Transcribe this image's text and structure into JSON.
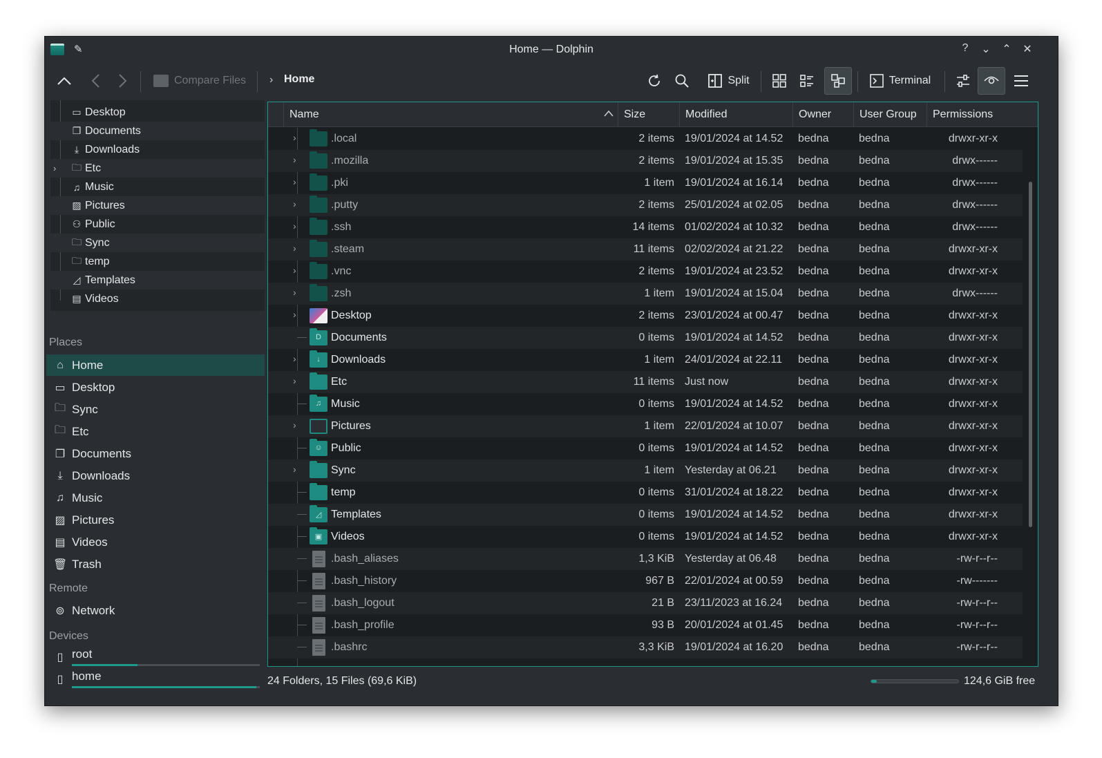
{
  "window": {
    "title": "Home — Dolphin",
    "controls": [
      "?",
      "⌄",
      "⌃",
      "✕"
    ]
  },
  "toolbar": {
    "compare_label": "Compare Files",
    "breadcrumb": "Home",
    "split_label": "Split",
    "terminal_label": "Terminal"
  },
  "folders_panel": [
    {
      "label": "Desktop",
      "icon": "desktop-icon",
      "expandable": false
    },
    {
      "label": "Documents",
      "icon": "documents-icon",
      "expandable": false
    },
    {
      "label": "Downloads",
      "icon": "downloads-icon",
      "expandable": false
    },
    {
      "label": "Etc",
      "icon": "folder-icon",
      "expandable": true
    },
    {
      "label": "Music",
      "icon": "music-icon",
      "expandable": false
    },
    {
      "label": "Pictures",
      "icon": "pictures-icon",
      "expandable": false
    },
    {
      "label": "Public",
      "icon": "public-icon",
      "expandable": false
    },
    {
      "label": "Sync",
      "icon": "folder-icon",
      "expandable": false
    },
    {
      "label": "temp",
      "icon": "folder-icon",
      "expandable": false
    },
    {
      "label": "Templates",
      "icon": "templates-icon",
      "expandable": false
    },
    {
      "label": "Videos",
      "icon": "videos-icon",
      "expandable": false
    }
  ],
  "places": {
    "heading": "Places",
    "items": [
      {
        "label": "Home",
        "icon": "home-icon",
        "selected": true
      },
      {
        "label": "Desktop",
        "icon": "desktop-icon"
      },
      {
        "label": "Sync",
        "icon": "folder-icon"
      },
      {
        "label": "Etc",
        "icon": "folder-icon"
      },
      {
        "label": "Documents",
        "icon": "documents-icon"
      },
      {
        "label": "Downloads",
        "icon": "downloads-icon"
      },
      {
        "label": "Music",
        "icon": "music-icon"
      },
      {
        "label": "Pictures",
        "icon": "pictures-icon"
      },
      {
        "label": "Videos",
        "icon": "videos-icon"
      },
      {
        "label": "Trash",
        "icon": "trash-icon"
      }
    ]
  },
  "remote": {
    "heading": "Remote",
    "items": [
      {
        "label": "Network",
        "icon": "network-icon"
      }
    ]
  },
  "devices": {
    "heading": "Devices",
    "items": [
      {
        "label": "root",
        "icon": "drive-icon",
        "usage": 0.35
      },
      {
        "label": "home",
        "icon": "drive-icon",
        "usage": 0.98
      }
    ]
  },
  "columns": {
    "name": "Name",
    "size": "Size",
    "modified": "Modified",
    "owner": "Owner",
    "group": "User Group",
    "permissions": "Permissions"
  },
  "files": [
    {
      "name": ".local",
      "kind": "folder",
      "hidden": true,
      "expandable": true,
      "size": "2 items",
      "modified": "19/01/2024 at 14.52",
      "owner": "bedna",
      "group": "bedna",
      "perm": "drwxr-xr-x"
    },
    {
      "name": ".mozilla",
      "kind": "folder",
      "hidden": true,
      "expandable": true,
      "size": "2 items",
      "modified": "19/01/2024 at 15.35",
      "owner": "bedna",
      "group": "bedna",
      "perm": "drwx------"
    },
    {
      "name": ".pki",
      "kind": "folder",
      "hidden": true,
      "expandable": true,
      "size": "1 item",
      "modified": "19/01/2024 at 16.14",
      "owner": "bedna",
      "group": "bedna",
      "perm": "drwx------"
    },
    {
      "name": ".putty",
      "kind": "folder",
      "hidden": true,
      "expandable": true,
      "size": "2 items",
      "modified": "25/01/2024 at 02.05",
      "owner": "bedna",
      "group": "bedna",
      "perm": "drwx------"
    },
    {
      "name": ".ssh",
      "kind": "folder",
      "hidden": true,
      "expandable": true,
      "size": "14 items",
      "modified": "01/02/2024 at 10.32",
      "owner": "bedna",
      "group": "bedna",
      "perm": "drwx------"
    },
    {
      "name": ".steam",
      "kind": "folder",
      "hidden": true,
      "expandable": true,
      "size": "11 items",
      "modified": "02/02/2024 at 21.22",
      "owner": "bedna",
      "group": "bedna",
      "perm": "drwxr-xr-x"
    },
    {
      "name": ".vnc",
      "kind": "folder",
      "hidden": true,
      "expandable": true,
      "size": "2 items",
      "modified": "19/01/2024 at 23.52",
      "owner": "bedna",
      "group": "bedna",
      "perm": "drwxr-xr-x"
    },
    {
      "name": ".zsh",
      "kind": "folder",
      "hidden": true,
      "expandable": true,
      "size": "1 item",
      "modified": "19/01/2024 at 15.04",
      "owner": "bedna",
      "group": "bedna",
      "perm": "drwx------"
    },
    {
      "name": "Desktop",
      "kind": "desktop",
      "hidden": false,
      "expandable": true,
      "size": "2 items",
      "modified": "23/01/2024 at 00.47",
      "owner": "bedna",
      "group": "bedna",
      "perm": "drwxr-xr-x"
    },
    {
      "name": "Documents",
      "kind": "folder",
      "glyph": "D",
      "hidden": false,
      "expandable": false,
      "size": "0 items",
      "modified": "19/01/2024 at 14.52",
      "owner": "bedna",
      "group": "bedna",
      "perm": "drwxr-xr-x"
    },
    {
      "name": "Downloads",
      "kind": "folder",
      "glyph": "↓",
      "hidden": false,
      "expandable": true,
      "size": "1 item",
      "modified": "24/01/2024 at 22.11",
      "owner": "bedna",
      "group": "bedna",
      "perm": "drwxr-xr-x"
    },
    {
      "name": "Etc",
      "kind": "folder",
      "hidden": false,
      "expandable": true,
      "size": "11 items",
      "modified": "Just now",
      "owner": "bedna",
      "group": "bedna",
      "perm": "drwxr-xr-x"
    },
    {
      "name": "Music",
      "kind": "folder",
      "glyph": "♫",
      "hidden": false,
      "expandable": false,
      "size": "0 items",
      "modified": "19/01/2024 at 14.52",
      "owner": "bedna",
      "group": "bedna",
      "perm": "drwxr-xr-x"
    },
    {
      "name": "Pictures",
      "kind": "pictures",
      "hidden": false,
      "expandable": true,
      "size": "1 item",
      "modified": "22/01/2024 at 10.07",
      "owner": "bedna",
      "group": "bedna",
      "perm": "drwxr-xr-x"
    },
    {
      "name": "Public",
      "kind": "folder",
      "glyph": "☺",
      "hidden": false,
      "expandable": false,
      "size": "0 items",
      "modified": "19/01/2024 at 14.52",
      "owner": "bedna",
      "group": "bedna",
      "perm": "drwxr-xr-x"
    },
    {
      "name": "Sync",
      "kind": "folder",
      "hidden": false,
      "expandable": true,
      "size": "1 item",
      "modified": "Yesterday at 06.21",
      "owner": "bedna",
      "group": "bedna",
      "perm": "drwxr-xr-x"
    },
    {
      "name": "temp",
      "kind": "folder",
      "hidden": false,
      "expandable": false,
      "size": "0 items",
      "modified": "31/01/2024 at 18.22",
      "owner": "bedna",
      "group": "bedna",
      "perm": "drwxr-xr-x"
    },
    {
      "name": "Templates",
      "kind": "folder",
      "glyph": "◿",
      "hidden": false,
      "expandable": false,
      "size": "0 items",
      "modified": "19/01/2024 at 14.52",
      "owner": "bedna",
      "group": "bedna",
      "perm": "drwxr-xr-x"
    },
    {
      "name": "Videos",
      "kind": "folder",
      "glyph": "▣",
      "hidden": false,
      "expandable": false,
      "size": "0 items",
      "modified": "19/01/2024 at 14.52",
      "owner": "bedna",
      "group": "bedna",
      "perm": "drwxr-xr-x"
    },
    {
      "name": ".bash_aliases",
      "kind": "file",
      "hidden": true,
      "expandable": false,
      "size": "1,3 KiB",
      "modified": "Yesterday at 06.48",
      "owner": "bedna",
      "group": "bedna",
      "perm": "-rw-r--r--"
    },
    {
      "name": ".bash_history",
      "kind": "file",
      "hidden": true,
      "expandable": false,
      "size": "967 B",
      "modified": "22/01/2024 at 00.59",
      "owner": "bedna",
      "group": "bedna",
      "perm": "-rw-------"
    },
    {
      "name": ".bash_logout",
      "kind": "file",
      "hidden": true,
      "expandable": false,
      "size": "21 B",
      "modified": "23/11/2023 at 16.24",
      "owner": "bedna",
      "group": "bedna",
      "perm": "-rw-r--r--"
    },
    {
      "name": ".bash_profile",
      "kind": "file",
      "hidden": true,
      "expandable": false,
      "size": "93 B",
      "modified": "20/01/2024 at 01.45",
      "owner": "bedna",
      "group": "bedna",
      "perm": "-rw-r--r--"
    },
    {
      "name": ".bashrc",
      "kind": "file",
      "hidden": true,
      "expandable": false,
      "size": "3,3 KiB",
      "modified": "19/01/2024 at 16.20",
      "owner": "bedna",
      "group": "bedna",
      "perm": "-rw-r--r--"
    }
  ],
  "status": {
    "summary": "24 Folders, 15 Files (69,6 KiB)",
    "free": "124,6 GiB free",
    "disk_usage": 0.06
  },
  "colors": {
    "accent": "#1d9a8c",
    "window_bg": "#2a2e32",
    "view_bg": "#1b1e20",
    "selection": "#1e4a47"
  }
}
